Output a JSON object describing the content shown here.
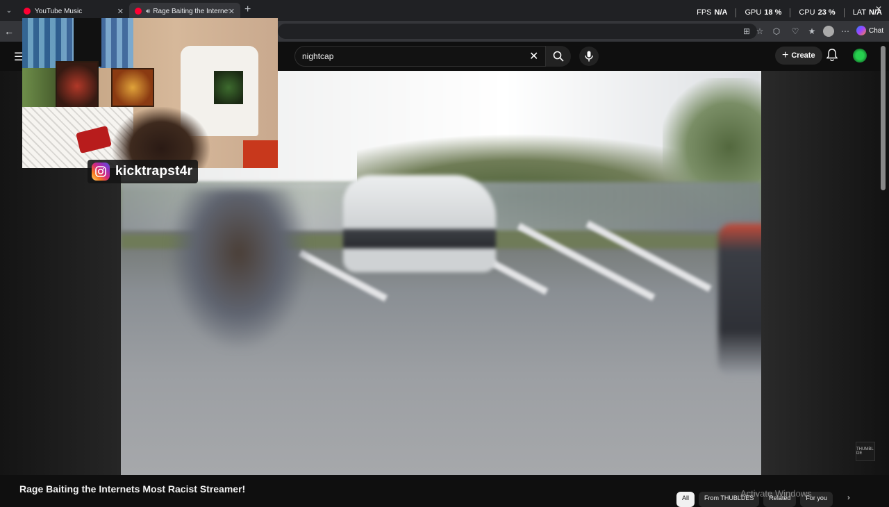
{
  "browser": {
    "tabs": [
      {
        "title": "YouTube Music",
        "active": false,
        "audio": false
      },
      {
        "title": "Rage Baiting the Internets Most Racist Streamer! - YouTube",
        "active": true,
        "audio": true
      }
    ],
    "new_tab_label": "+",
    "copilot_label": "Chat"
  },
  "perf_overlay": {
    "fps_label": "FPS",
    "fps_value": "N/A",
    "gpu_label": "GPU",
    "gpu_value": "18 %",
    "cpu_label": "CPU",
    "cpu_value": "23 %",
    "lat_label": "LAT",
    "lat_value": "N/A"
  },
  "youtube": {
    "search_value": "nightcap",
    "create_label": "Create",
    "video_title": "Rage Baiting the Internets Most Racist Streamer!",
    "video_badge": "THUMBL DE",
    "chips": [
      "All",
      "From THUBLDES",
      "Related",
      "For you"
    ],
    "active_chip": "All"
  },
  "overlay": {
    "instagram_handle": "kicktrapst4r"
  },
  "system": {
    "watermark": "Activate Windows"
  },
  "colors": {
    "youtube_red": "#ff0033",
    "background": "#0f0f0f",
    "accent_green": "#26d04e"
  }
}
